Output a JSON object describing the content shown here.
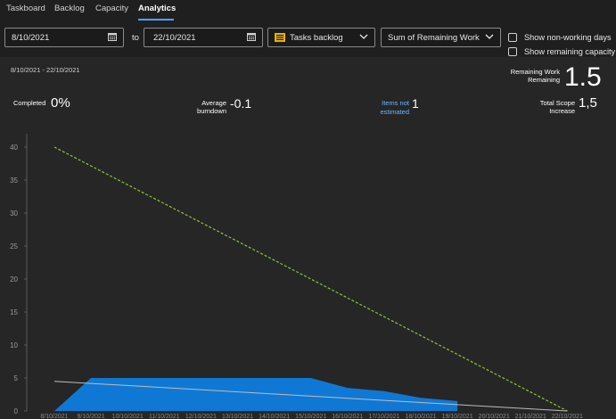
{
  "tabs": [
    "Taskboard",
    "Backlog",
    "Capacity",
    "Analytics"
  ],
  "filters": {
    "start_date": "8/10/2021",
    "to_label": "to",
    "end_date": "22/10/2021",
    "backlog": "Tasks backlog",
    "metric": "Sum of Remaining Work",
    "show_non_working_days": "Show non-working days",
    "show_remaining_capacity": "Show remaining capacity"
  },
  "summary": {
    "date_range": "8/10/2021 - 22/10/2021",
    "remaining_work_label_1": "Remaining Work",
    "remaining_work_label_2": "Remaining",
    "remaining_work_value": "1.5",
    "completed_label": "Completed",
    "completed_value": "0%",
    "avg_burndown_label_1": "Average",
    "avg_burndown_label_2": "burndown",
    "avg_burndown_value": "-0.1",
    "items_not_estimated_label_1": "Items not",
    "items_not_estimated_label_2": "estimated",
    "items_not_estimated_value": "1",
    "scope_increase_label_1": "Total Scope",
    "scope_increase_label_2": "Increase",
    "scope_increase_value": "1,5"
  },
  "colors": {
    "accent": "#4aa3ff",
    "area": "#0f78d4",
    "ideal": "#8cc43c",
    "trend": "#bdbdbd"
  },
  "chart_data": {
    "type": "area",
    "x": [
      "8/10/2021",
      "9/10/2021",
      "10/10/2021",
      "11/10/2021",
      "12/10/2021",
      "13/10/2021",
      "14/10/2021",
      "15/10/2021",
      "16/10/2021",
      "17/10/2021",
      "18/10/2021",
      "19/10/2021",
      "20/10/2021",
      "21/10/2021",
      "22/10/2021"
    ],
    "ylim": [
      0,
      40
    ],
    "yticks": [
      0,
      5,
      10,
      15,
      20,
      25,
      30,
      35,
      40
    ],
    "series": [
      {
        "values": [
          0,
          5,
          5,
          5,
          5,
          5,
          5,
          5,
          3.5,
          3,
          2,
          1.5,
          null,
          null,
          null
        ]
      },
      {
        "values": [
          40,
          null,
          null,
          null,
          null,
          null,
          null,
          null,
          null,
          null,
          null,
          null,
          null,
          null,
          0
        ]
      },
      {
        "values": [
          4.5,
          null,
          null,
          null,
          null,
          null,
          null,
          null,
          null,
          null,
          null,
          null,
          null,
          null,
          0
        ]
      }
    ]
  }
}
